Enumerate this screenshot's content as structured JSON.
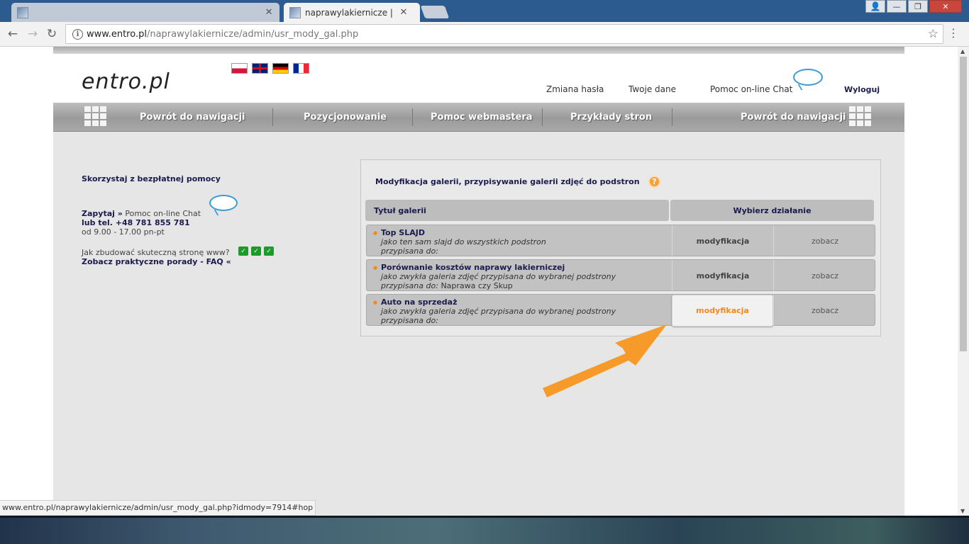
{
  "browser": {
    "tabs": [
      {
        "title": "",
        "close": "✕"
      },
      {
        "title": "naprawylakiernicze | adm",
        "close": "✕"
      }
    ],
    "url_host": "www.entro.pl",
    "url_path": "/naprawylakiernicze/admin/usr_mody_gal.php",
    "status_url": "www.entro.pl/naprawylakiernicze/admin/usr_mody_gal.php?idmody=7914#hop"
  },
  "header": {
    "logo": "entro.pl",
    "links": {
      "change_password": "Zmiana hasła",
      "your_data": "Twoje dane",
      "chat": "Pomoc on-line Chat",
      "logout": "Wyloguj"
    }
  },
  "nav": {
    "items": [
      "Powrót do nawigacji",
      "Pozycjonowanie",
      "Pomoc webmastera",
      "Przykłady stron",
      "Powrót do nawigacji"
    ]
  },
  "sidebar": {
    "title": "Skorzystaj z bezpłatnej pomocy",
    "ask": "Zapytaj »",
    "chat": "Pomoc on-line Chat",
    "phone": "lub tel. +48 781 855 781",
    "hours": "od 9.00 - 17.00 pn-pt",
    "how_to": "Jak zbudować skuteczną stronę www?",
    "faq": "Zobacz praktyczne porady - FAQ «"
  },
  "panel": {
    "title": "Modyfikacja galerii, przypisywanie galerii zdjęć do podstron",
    "help": "?",
    "col_title": "Tytuł galerii",
    "col_action": "Wybierz działanie",
    "rows": [
      {
        "name": "Top SLAJD",
        "desc": "jako ten sam slajd do wszystkich podstron",
        "assigned_label": "przypisana do:",
        "assigned_value": "",
        "modify": "modyfikacja",
        "view": "zobacz"
      },
      {
        "name": "Porównanie kosztów naprawy lakierniczej",
        "desc": "jako zwykła galeria zdjęć przypisana do wybranej podstrony",
        "assigned_label": "przypisana do:",
        "assigned_value": "Naprawa czy Skup",
        "modify": "modyfikacja",
        "view": "zobacz"
      },
      {
        "name": "Auto na sprzedaż",
        "desc": "jako zwykła galeria zdjęć przypisana do wybranej podstrony",
        "assigned_label": "przypisana do:",
        "assigned_value": "",
        "modify": "modyfikacja",
        "view": "zobacz"
      }
    ]
  },
  "colors": {
    "accent": "#f28a1b",
    "nav_text": "#ffffff",
    "link": "#1b1b4d"
  }
}
